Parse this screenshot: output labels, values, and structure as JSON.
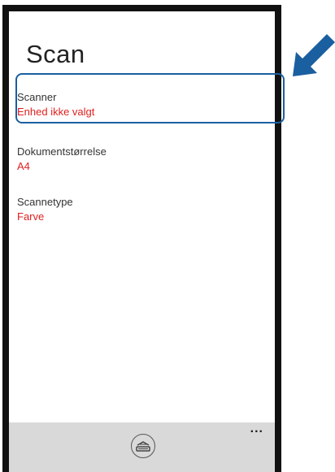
{
  "page": {
    "title": "Scan"
  },
  "settings": [
    {
      "label": "Scanner",
      "value": "Enhed ikke valgt"
    },
    {
      "label": "Dokumentstørrelse",
      "value": "A4"
    },
    {
      "label": "Scannetype",
      "value": "Farve"
    }
  ],
  "app_bar": {
    "scan_icon": "scan-icon",
    "more_label": "..."
  },
  "annotation": {
    "arrow_icon": "pointer-arrow-icon",
    "highlight_color": "#1a5fa0"
  },
  "colors": {
    "value_text": "#e02020",
    "app_bar_bg": "#d9d9d9"
  }
}
